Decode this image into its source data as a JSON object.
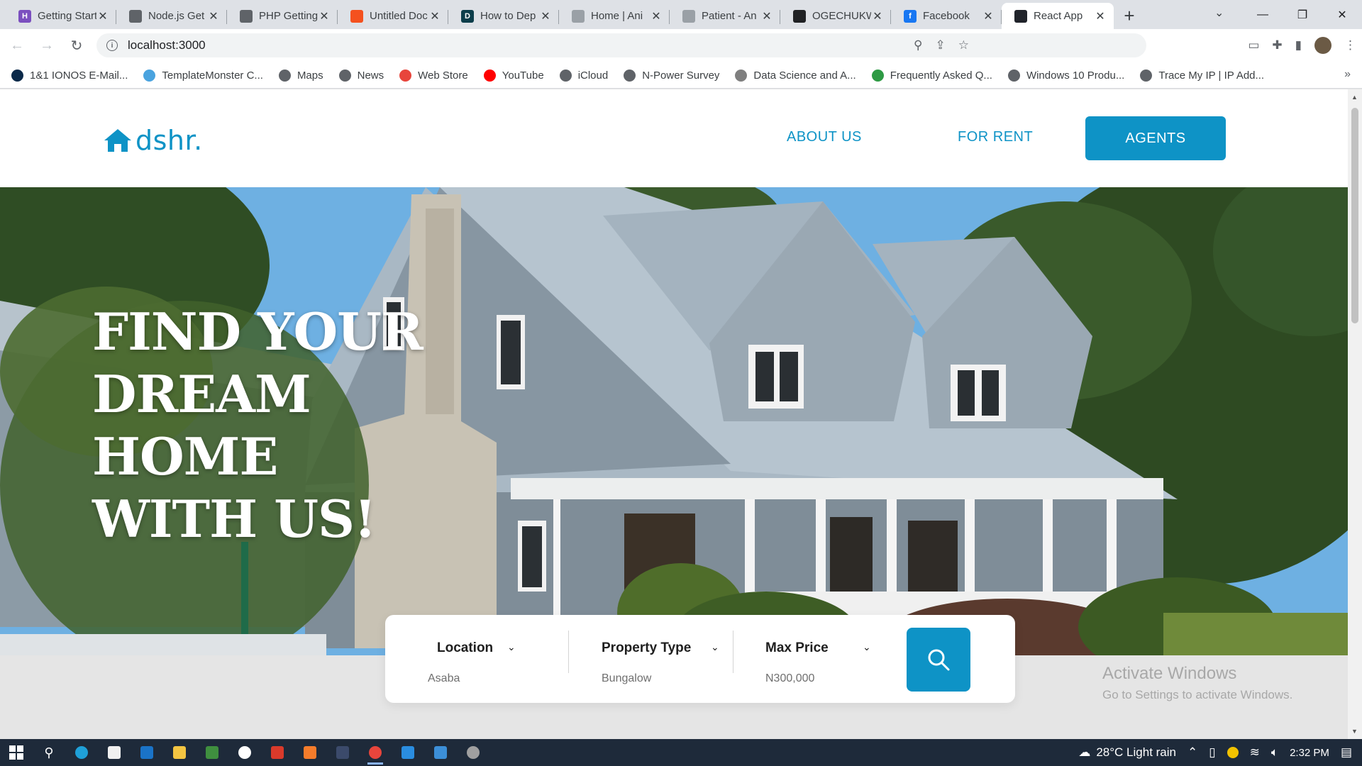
{
  "browser": {
    "tabs": [
      {
        "title": "Getting Started",
        "color": "#7b4fbf",
        "glyph": "H"
      },
      {
        "title": "Node.js Get",
        "color": "#5f6368",
        "glyph": ""
      },
      {
        "title": "PHP Getting",
        "color": "#5f6368",
        "glyph": ""
      },
      {
        "title": "Untitled Doc",
        "color": "#f4511e",
        "glyph": ""
      },
      {
        "title": "How to Dep",
        "color": "#0b3d4a",
        "glyph": "D"
      },
      {
        "title": "Home | Ani",
        "color": "#9aa0a6",
        "glyph": ""
      },
      {
        "title": "Patient - An",
        "color": "#9aa0a6",
        "glyph": ""
      },
      {
        "title": "OGECHUKW",
        "color": "#202124",
        "glyph": ""
      },
      {
        "title": "Facebook",
        "color": "#1877f2",
        "glyph": "f"
      },
      {
        "title": "React App",
        "color": "#20232a",
        "glyph": ""
      }
    ],
    "active_tab_index": 9,
    "new_tab_glyph": "+",
    "url": "localhost:3000",
    "bookmarks": [
      {
        "label": "1&1 IONOS E-Mail...",
        "color": "#0b2a4a"
      },
      {
        "label": "TemplateMonster C...",
        "color": "#4aa3df"
      },
      {
        "label": "Maps",
        "color": "#5f6368"
      },
      {
        "label": "News",
        "color": "#5f6368"
      },
      {
        "label": "Web Store",
        "color": "#e8453c"
      },
      {
        "label": "YouTube",
        "color": "#ff0000"
      },
      {
        "label": "iCloud",
        "color": "#5f6368"
      },
      {
        "label": "N-Power Survey",
        "color": "#5f6368"
      },
      {
        "label": "Data Science and A...",
        "color": "#7f7f7f"
      },
      {
        "label": "Frequently Asked Q...",
        "color": "#2e9a44"
      },
      {
        "label": "Windows 10 Produ...",
        "color": "#5f6368"
      },
      {
        "label": "Trace My IP | IP Add...",
        "color": "#5f6368"
      }
    ]
  },
  "site": {
    "logo_text": "dshr.",
    "nav": {
      "about": "ABOUT US",
      "rent": "FOR RENT",
      "agents": "AGENTS"
    },
    "hero_title": [
      "FIND YOUR",
      "DREAM",
      "HOME",
      "WITH US!"
    ],
    "search": {
      "location_label": "Location",
      "location_value": "Asaba",
      "type_label": "Property Type",
      "type_value": "Bungalow",
      "price_label": "Max Price",
      "price_value": "N300,000"
    },
    "accent_color": "#0e93c6"
  },
  "watermark": {
    "line1": "Activate Windows",
    "line2": "Go to Settings to activate Windows."
  },
  "taskbar": {
    "weather": "28°C  Light rain",
    "time": "2:32 PM"
  }
}
